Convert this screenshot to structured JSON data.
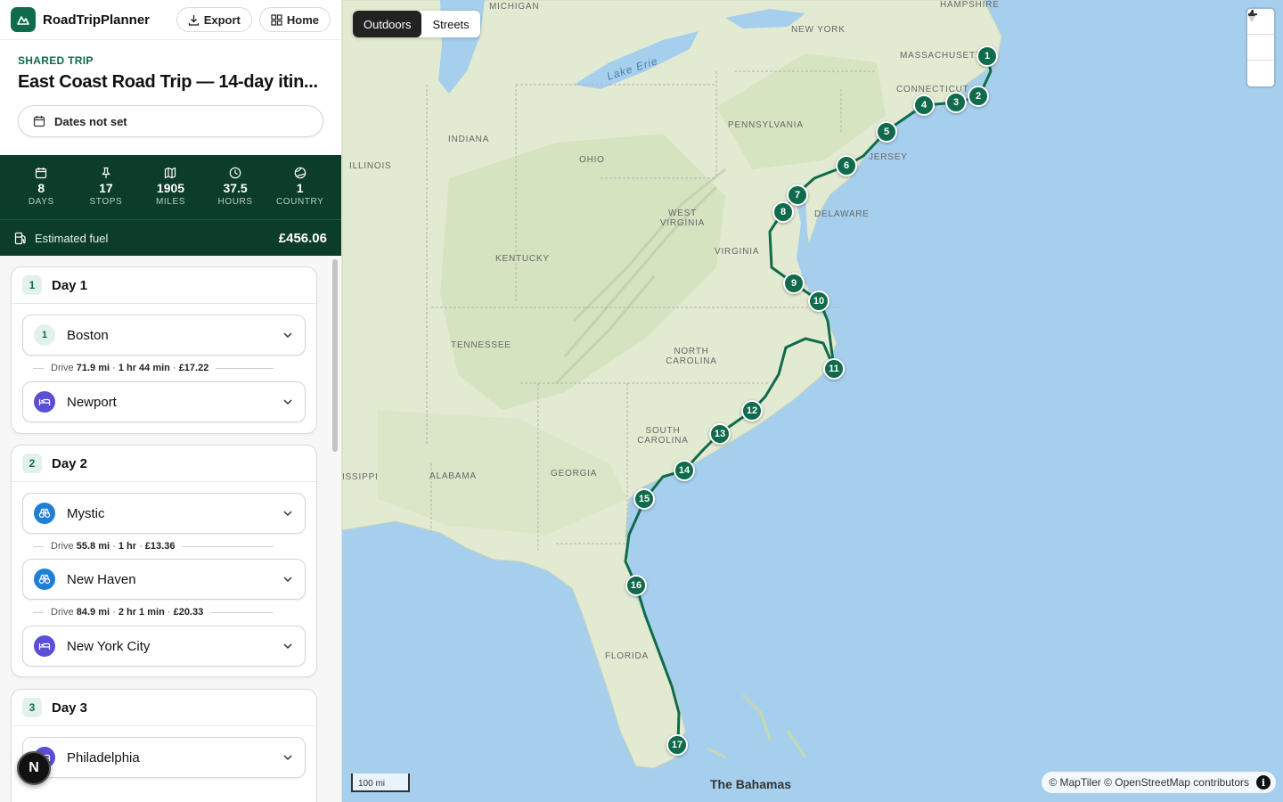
{
  "app": {
    "title": "RoadTripPlanner",
    "export_label": "Export",
    "home_label": "Home"
  },
  "trip": {
    "kicker": "SHARED TRIP",
    "title": "East Coast Road Trip — 14-day itin...",
    "dates_label": "Dates not set"
  },
  "stats": [
    {
      "icon": "calendar-icon",
      "value": "8",
      "label": "DAYS"
    },
    {
      "icon": "pin-icon",
      "value": "17",
      "label": "STOPS"
    },
    {
      "icon": "map-icon",
      "value": "1905",
      "label": "MILES"
    },
    {
      "icon": "clock-icon",
      "value": "37.5",
      "label": "HOURS"
    },
    {
      "icon": "globe-icon",
      "value": "1",
      "label": "COUNTRY"
    }
  ],
  "fuel": {
    "label": "Estimated fuel",
    "value": "£456.06"
  },
  "days": [
    {
      "num": "1",
      "label": "Day 1",
      "stops": [
        {
          "badge": "1",
          "type": "number",
          "name": "Boston"
        },
        {
          "badge": "",
          "type": "hotel",
          "name": "Newport"
        }
      ],
      "drives": [
        {
          "prefix": "Drive",
          "dist": "71.9 mi",
          "time": "1 hr 44 min",
          "cost": "£17.22"
        }
      ]
    },
    {
      "num": "2",
      "label": "Day 2",
      "stops": [
        {
          "badge": "",
          "type": "sight",
          "name": "Mystic"
        },
        {
          "badge": "",
          "type": "sight",
          "name": "New Haven"
        },
        {
          "badge": "",
          "type": "hotel",
          "name": "New York City"
        }
      ],
      "drives": [
        {
          "prefix": "Drive",
          "dist": "55.8 mi",
          "time": "1 hr",
          "cost": "£13.36"
        },
        {
          "prefix": "Drive",
          "dist": "84.9 mi",
          "time": "2 hr 1 min",
          "cost": "£20.33"
        }
      ]
    },
    {
      "num": "3",
      "label": "Day 3",
      "stops": [
        {
          "badge": "",
          "type": "hotel",
          "name": "Philadelphia"
        }
      ],
      "drives": []
    }
  ],
  "floating_button_label": "N",
  "map": {
    "layers": {
      "active": "Outdoors",
      "other": "Streets"
    },
    "scale_label": "100 mi",
    "attribution": "© MapTiler © OpenStreetMap contributors",
    "info_label": "i",
    "water_label": "Lake Erie",
    "sea_label": "The Bahamas",
    "place_labels": [
      "MICHIGAN",
      "NEW YORK",
      "HAMPSHIRE",
      "MASSACHUSETTS",
      "CONNECTICUT",
      "PENNSYLVANIA",
      "INDIANA",
      "OHIO",
      "ILLINOIS",
      "JERSEY",
      "DELAWARE",
      "WEST VIRGINIA",
      "VIRGINIA",
      "KENTUCKY",
      "TENNESSEE",
      "NORTH CAROLINA",
      "SOUTH CAROLINA",
      "GEORGIA",
      "ALABAMA",
      "ISSIPPI",
      "FLORIDA"
    ],
    "markers": [
      "1",
      "2",
      "3",
      "4",
      "5",
      "6",
      "7",
      "8",
      "9",
      "10",
      "11",
      "12",
      "13",
      "14",
      "15",
      "16",
      "17"
    ],
    "route_color": "#0f6b4b",
    "water_color": "#a6cfee",
    "land_color": "#dfe8cf"
  }
}
